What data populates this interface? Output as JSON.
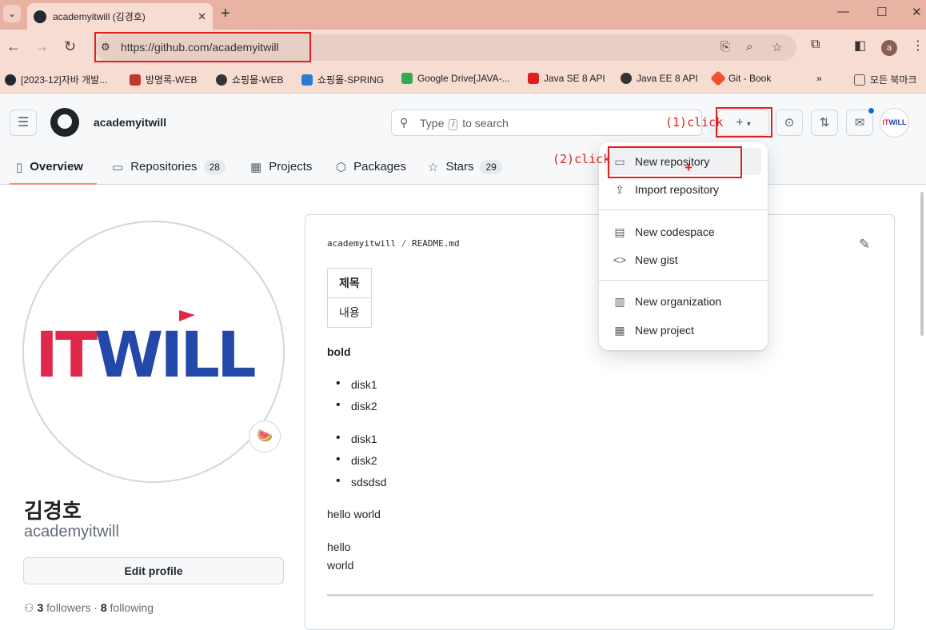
{
  "browser": {
    "tab_title": "academyitwill (김경호)",
    "url": "https://github.com/academyitwill",
    "bookmarks": [
      {
        "label": "[2023-12]자바 개발...",
        "color": "#24292f"
      },
      {
        "label": "방명록-WEB",
        "color": "#c0392b"
      },
      {
        "label": "쇼핑몰-WEB",
        "color": "#333333"
      },
      {
        "label": "쇼핑몰-SPRING",
        "color": "#2a7bd3"
      },
      {
        "label": "Google Drive[JAVA-...",
        "color": "#34a853"
      },
      {
        "label": "Java SE 8 API",
        "color": "#e02020"
      },
      {
        "label": "Java EE 8 API",
        "color": "#333333"
      },
      {
        "label": "Git - Book",
        "color": "#f05133"
      },
      {
        "label": "모든 북마크",
        "color": "#555555"
      }
    ]
  },
  "header": {
    "username": "academyitwill",
    "search_placeholder_pre": "Type",
    "search_slash": "/",
    "search_placeholder_post": "to search",
    "avatar_it": "IT",
    "avatar_will": "WILL"
  },
  "annotations": {
    "step1": "(1)click",
    "step2": "(2)click"
  },
  "nav_tabs": [
    {
      "label": "Overview",
      "icon": "book-icon"
    },
    {
      "label": "Repositories",
      "count": "28",
      "icon": "repo-icon"
    },
    {
      "label": "Projects",
      "icon": "table-icon"
    },
    {
      "label": "Packages",
      "icon": "package-icon"
    },
    {
      "label": "Stars",
      "count": "29",
      "icon": "star-icon"
    }
  ],
  "dropdown": {
    "items": [
      {
        "label": "New repository",
        "icon": "repo-icon"
      },
      {
        "label": "Import repository",
        "icon": "repo-push-icon"
      },
      {
        "label": "New codespace",
        "icon": "codespaces-icon"
      },
      {
        "label": "New gist",
        "icon": "code-icon"
      },
      {
        "label": "New organization",
        "icon": "organization-icon"
      },
      {
        "label": "New project",
        "icon": "table-icon"
      }
    ]
  },
  "profile": {
    "name": "김경호",
    "login": "academyitwill",
    "logo_it": "IT",
    "logo_will": "WILL",
    "status_emoji": "🍉",
    "edit_label": "Edit profile",
    "followers_count": "3",
    "followers_label": "followers",
    "following_count": "8",
    "following_label": "following"
  },
  "readme": {
    "owner": "academyitwill",
    "separator": "/",
    "file": "README.md",
    "table_header": "제목",
    "table_cell": "내용",
    "bold_text": "bold",
    "list1": [
      "disk1",
      "disk2"
    ],
    "list2": [
      "disk1",
      "disk2",
      "sdsdsd"
    ],
    "para1": "hello world",
    "para2_line1": "hello",
    "para2_line2": "world"
  },
  "colors": {
    "chrome_frame": "#e9b3a3",
    "annotation_red": "#e02020",
    "tab_underline": "#fd8c73",
    "itwill_red": "#e0284a",
    "itwill_blue": "#2348a8"
  }
}
